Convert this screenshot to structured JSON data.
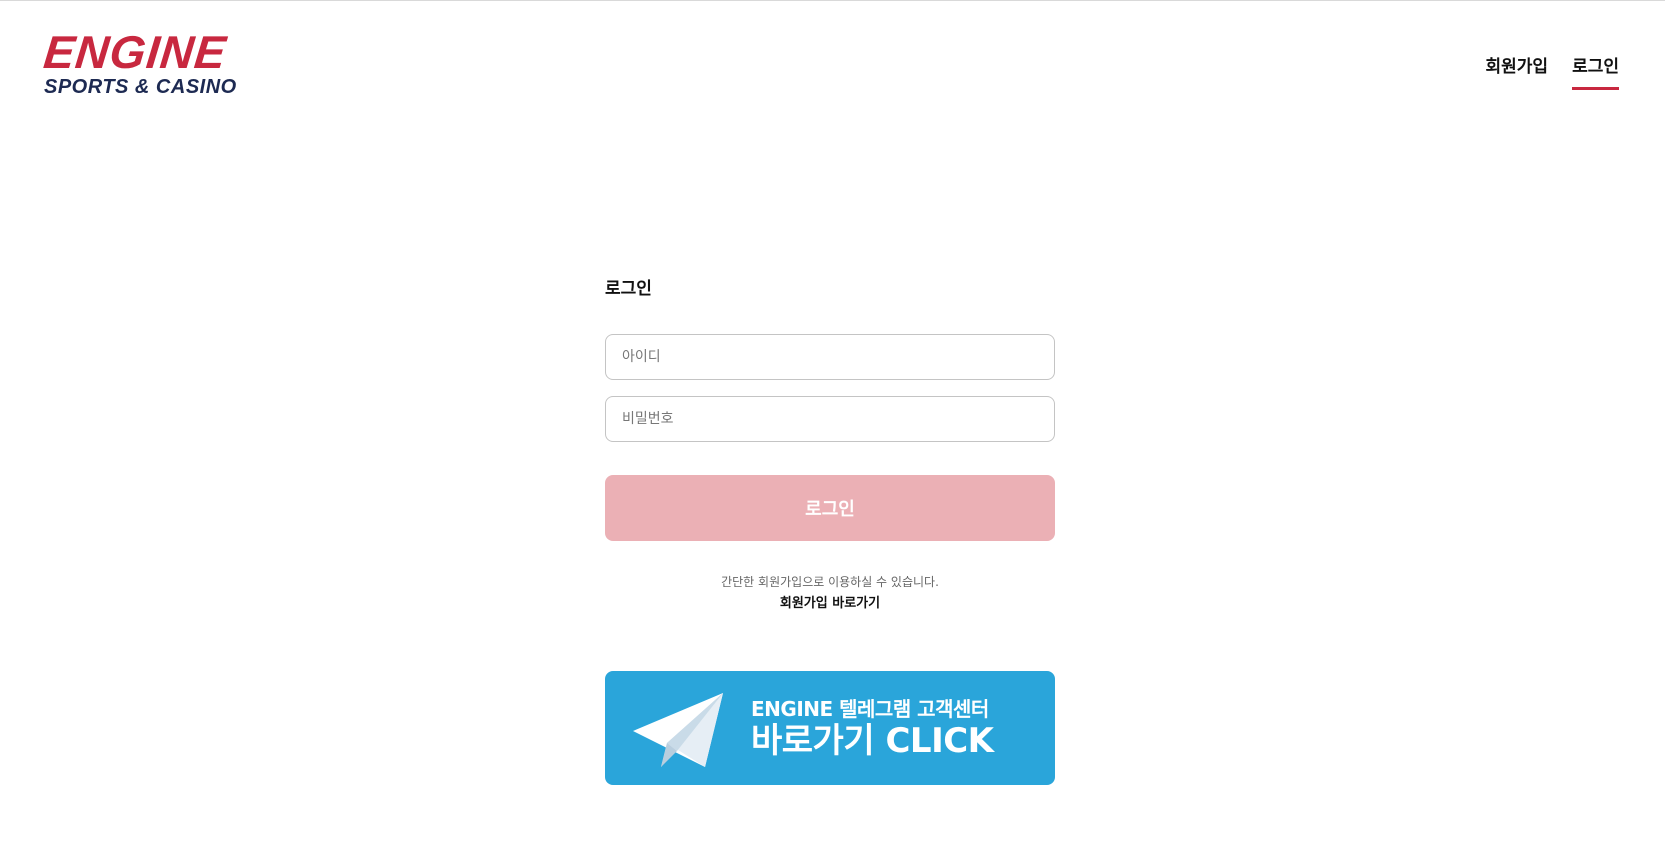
{
  "header": {
    "logo_main": "ENGINE",
    "logo_sub": "SPORTS & CASINO",
    "nav": [
      {
        "label": "회원가입"
      },
      {
        "label": "로그인",
        "active": true
      }
    ]
  },
  "login": {
    "title": "로그인",
    "id_placeholder": "아이디",
    "id_value": "",
    "pw_placeholder": "비밀번호",
    "pw_value": "",
    "submit_label": "로그인",
    "signup_note": "간단한 회원가입으로 이용하실 수 있습니다.",
    "signup_link": "회원가입 바로가기"
  },
  "telegram_banner": {
    "line1": "ENGINE 텔레그램 고객센터",
    "line2": "바로가기 CLICK",
    "icon": "telegram-paper-plane-icon"
  },
  "colors": {
    "brand_red": "#c8283f",
    "brand_navy": "#1d2a52",
    "button_disabled": "#ebb0b5",
    "telegram_blue": "#2aa5da"
  }
}
